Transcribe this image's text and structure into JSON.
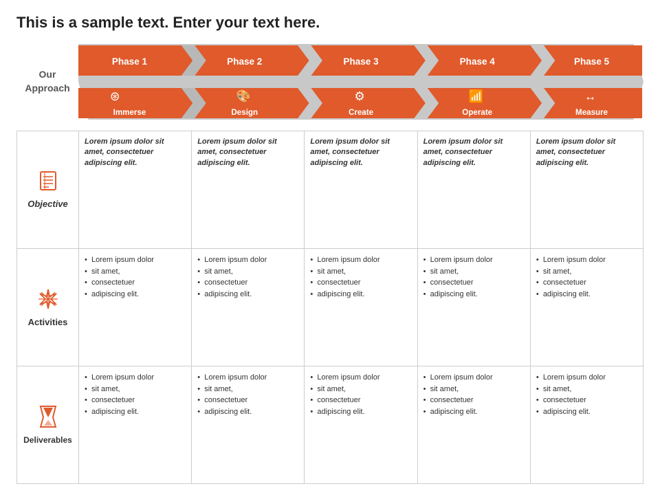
{
  "title": "This is a sample text. Enter your text here.",
  "approach_label": "Our\nApproach",
  "phases": [
    {
      "id": 1,
      "label": "Phase 1",
      "icon_label": "Immerse",
      "icon": "⊛"
    },
    {
      "id": 2,
      "label": "Phase 2",
      "icon_label": "Design",
      "icon": "🎨"
    },
    {
      "id": 3,
      "label": "Phase 3",
      "icon_label": "Create",
      "icon": "⚙"
    },
    {
      "id": 4,
      "label": "Phase 4",
      "icon_label": "Operate",
      "icon": "📊"
    },
    {
      "id": 5,
      "label": "Phase 5",
      "icon_label": "Measure",
      "icon": "↔"
    }
  ],
  "rows": [
    {
      "id": "objective",
      "label": "Objective",
      "icon": "📋",
      "type": "italic",
      "cells": [
        "Lorem ipsum dolor sit amet, consectetuer adipiscing elit.",
        "Lorem ipsum dolor sit amet, consectetuer adipiscing elit.",
        "Lorem ipsum dolor sit amet, consectetuer adipiscing elit.",
        "Lorem ipsum dolor sit amet, consectetuer adipiscing elit.",
        "Lorem ipsum dolor sit amet, consectetuer adipiscing elit."
      ]
    },
    {
      "id": "activities",
      "label": "Activities",
      "icon": "✦",
      "type": "list",
      "cells": [
        [
          "Lorem ipsum dolor",
          "sit amet,",
          "consectetuer",
          "adipiscing elit."
        ],
        [
          "Lorem ipsum dolor",
          "sit amet,",
          "consectetuer",
          "adipiscing elit."
        ],
        [
          "Lorem ipsum dolor",
          "sit amet,",
          "consectetuer",
          "adipiscing elit."
        ],
        [
          "Lorem ipsum dolor",
          "sit amet,",
          "consectetuer",
          "adipiscing elit."
        ],
        [
          "Lorem ipsum dolor",
          "sit amet,",
          "consectetuer",
          "adipiscing elit."
        ]
      ]
    },
    {
      "id": "deliverables",
      "label": "Deliverables",
      "icon": "⧗",
      "type": "list",
      "cells": [
        [
          "Lorem ipsum dolor",
          "sit amet,",
          "consectetuer",
          "adipiscing elit."
        ],
        [
          "Lorem ipsum dolor",
          "sit amet,",
          "consectetuer",
          "adipiscing elit."
        ],
        [
          "Lorem ipsum dolor",
          "sit amet,",
          "consectetuer",
          "adipiscing elit."
        ],
        [
          "Lorem ipsum dolor",
          "sit amet,",
          "consectetuer",
          "adipiscing elit."
        ],
        [
          "Lorem ipsum dolor",
          "sit amet,",
          "consectetuer",
          "adipiscing elit."
        ]
      ]
    }
  ],
  "colors": {
    "orange": "#e05a2b",
    "gray": "#b0b0b0",
    "light_gray": "#d0d0d0",
    "white": "#ffffff",
    "text_dark": "#222222"
  }
}
